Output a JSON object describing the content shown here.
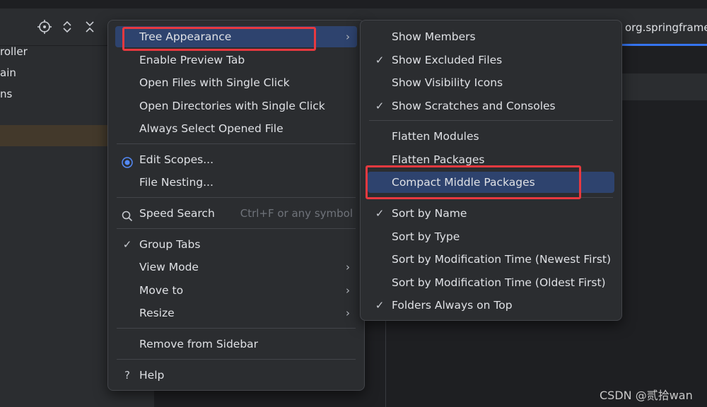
{
  "project_panel": {
    "tree_items": [
      "roller",
      "ain",
      "ns"
    ]
  },
  "editor": {
    "tab_title": "org.springframe"
  },
  "main_menu": {
    "items": [
      {
        "label": "Tree Appearance",
        "arrow": "›",
        "highlighted": true
      },
      {
        "label": "Enable Preview Tab"
      },
      {
        "label": "Open Files with Single Click"
      },
      {
        "label": "Open Directories with Single Click"
      },
      {
        "label": "Always Select Opened File"
      },
      {
        "label": "Edit Scopes...",
        "icon": "scope-icon"
      },
      {
        "label": "File Nesting..."
      },
      {
        "label": "Speed Search",
        "icon": "search-icon",
        "shortcut": "Ctrl+F or any symbol"
      },
      {
        "label": "Group Tabs",
        "check": "✓"
      },
      {
        "label": "View Mode",
        "arrow": "›"
      },
      {
        "label": "Move to",
        "arrow": "›"
      },
      {
        "label": "Resize",
        "arrow": "›"
      },
      {
        "label": "Remove from Sidebar"
      },
      {
        "label": "Help",
        "icon": "help-icon",
        "icon_glyph": "?"
      }
    ]
  },
  "sub_menu": {
    "items": [
      {
        "label": "Show Members"
      },
      {
        "label": "Show Excluded Files",
        "check": "✓"
      },
      {
        "label": "Show Visibility Icons"
      },
      {
        "label": "Show Scratches and Consoles",
        "check": "✓"
      },
      {
        "label": "Flatten Modules"
      },
      {
        "label": "Flatten Packages"
      },
      {
        "label": "Compact Middle Packages",
        "highlighted": true
      },
      {
        "label": "Sort by Name",
        "check": "✓"
      },
      {
        "label": "Sort by Type"
      },
      {
        "label": "Sort by Modification Time (Newest First)"
      },
      {
        "label": "Sort by Modification Time (Oldest First)"
      },
      {
        "label": "Folders Always on Top",
        "check": "✓"
      }
    ]
  },
  "watermark": "CSDN @贰拾wan",
  "colors": {
    "highlight": "#2e436e",
    "annotation_red": "#e8393f",
    "menu_bg": "#2b2d30"
  }
}
